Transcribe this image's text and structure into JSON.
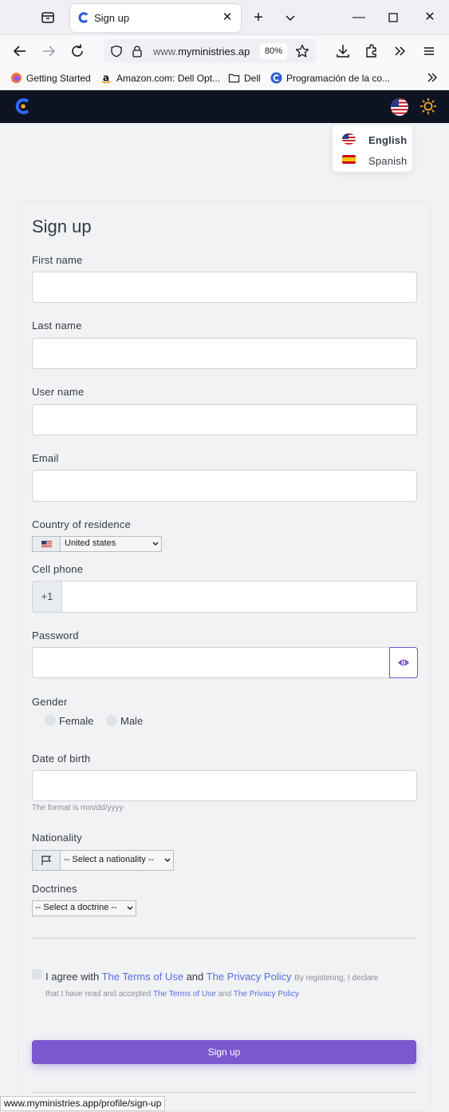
{
  "browser": {
    "tab_title": "Sign up",
    "url_prefix": "www.",
    "url_domain": "myministries.ap",
    "zoom": "80%",
    "bookmarks": [
      "Getting Started",
      "Amazon.com: Dell Opt...",
      "Dell",
      "Programación de la co..."
    ],
    "status_url": "www.myministries.app/profile/sign-up"
  },
  "language_menu": {
    "items": [
      "English",
      "Spanish"
    ]
  },
  "form": {
    "title": "Sign up",
    "first_name_label": "First name",
    "last_name_label": "Last name",
    "user_name_label": "User name",
    "email_label": "Email",
    "country_label": "Country of residence",
    "country_value": "United states",
    "cell_phone_label": "Cell phone",
    "phone_prefix": "+1",
    "password_label": "Password",
    "gender_label": "Gender",
    "gender_options": [
      "Female",
      "Male"
    ],
    "dob_label": "Date of birth",
    "dob_hint": "The format is mm/dd/yyyy",
    "nationality_label": "Nationality",
    "nationality_placeholder": "-- Select a nationality --",
    "doctrines_label": "Doctrines",
    "doctrine_placeholder": "-- Select a doctrine --",
    "agree_prefix": "I agree with",
    "terms_link": "The Terms of Use",
    "and_word": "and",
    "privacy_link": "The Privacy Policy",
    "declare_text": "By registering, I declare",
    "declare_text_2": "that I have read and accepted",
    "submit_label": "Sign up"
  },
  "colors": {
    "appbar": "#0d1321",
    "accent": "#7c57cd",
    "link": "#5a6ee0"
  }
}
